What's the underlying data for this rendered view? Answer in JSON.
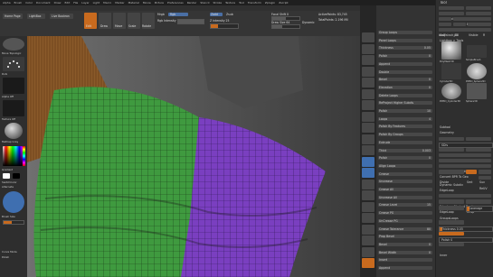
{
  "menu": {
    "items": [
      "Alpha",
      "Brush",
      "Color",
      "Document",
      "Draw",
      "Edit",
      "File",
      "Layer",
      "Light",
      "Macro",
      "Marker",
      "Material",
      "Movie",
      "Picture",
      "Preferences",
      "Render",
      "Stencil",
      "Stroke",
      "Texture",
      "Tool",
      "Transform",
      "Zplugin",
      "Zscript"
    ]
  },
  "toolbar": {
    "home_page": "Home Page",
    "lightbox": "LightBox",
    "live_boolean": "Live Boolean",
    "edit": "Edit",
    "draw": "Draw",
    "move": "Move",
    "scale": "Scale",
    "rotate": "Rotate",
    "mrgb": "Mrgb",
    "rgb": "Rgb",
    "rgb_intensity": "Rgb Intensity",
    "zadd": "Zadd",
    "zsub": "Zsub",
    "z_intensity": "Z Intensity 25",
    "focal_shift": "Focal Shift 0",
    "draw_size": "Draw Size 64",
    "dynamic": "Dynamic",
    "active_points": "ActivePoints: 83,745",
    "total_points": "TotalPoints: 2.196 Mil",
    "rgb_value": 1.0,
    "z_intensity_value": 0.25,
    "focal_value": 0.5,
    "draw_size_value": 0.35
  },
  "left_shelf": {
    "brush_label": "Move Topologic",
    "stroke_label": "Dots",
    "alpha_label": "Alpha Off",
    "texture_label": "Texture Off",
    "material_label": "MatCap Gray",
    "gradient_label": "Gradient",
    "switch_color": "SwitchColor",
    "alternate": "Alternate",
    "brush_size_label": "Brush Size",
    "curve_mode": "Curve Mode",
    "polish_label": "Polish"
  },
  "right_shelf": {
    "icons": [
      "bpr-icon",
      "spix-icon",
      "scroll-icon",
      "zoom-icon",
      "actual-icon",
      "aahalf-icon",
      "persp-icon",
      "floor-icon",
      "local-icon",
      "lsym-icon",
      "xyz-icon",
      "frame-icon",
      "move-icon",
      "scale-icon",
      "rotate-icon",
      "linefill-icon",
      "polyf-icon",
      "transp-icon",
      "ghost-icon",
      "solo-icon",
      "xpose-icon"
    ]
  },
  "mid_panel": {
    "sections": [
      {
        "label": "Group Loops",
        "value": ""
      },
      {
        "label": "Panel Loops",
        "value": ""
      },
      {
        "label": "Thickness",
        "value": "0.05"
      },
      {
        "label": "Polish",
        "value": "0"
      },
      {
        "label": "Append",
        "value": ""
      },
      {
        "label": "Double",
        "value": ""
      },
      {
        "label": "Bevel",
        "value": "0"
      },
      {
        "label": "Elevation",
        "value": "0"
      },
      {
        "label": "Delete Loops",
        "value": ""
      },
      {
        "label": "ReProject Higher Subdiv",
        "value": ""
      },
      {
        "label": "Polish",
        "value": "10"
      },
      {
        "label": "Loops",
        "value": "4"
      },
      {
        "label": "Polish By Features",
        "value": ""
      },
      {
        "label": "Polish By Groups",
        "value": ""
      },
      {
        "label": "Extrude",
        "value": ""
      },
      {
        "label": "Thick",
        "value": "0.003"
      },
      {
        "label": "Polish",
        "value": "0"
      },
      {
        "label": "Align Loops",
        "value": ""
      },
      {
        "label": "Crease",
        "value": ""
      },
      {
        "label": "Uncrease",
        "value": ""
      },
      {
        "label": "Crease All",
        "value": ""
      },
      {
        "label": "Uncrease All",
        "value": ""
      },
      {
        "label": "Crease Level",
        "value": "15"
      },
      {
        "label": "Crease PG",
        "value": ""
      },
      {
        "label": "UnCrease PG",
        "value": ""
      },
      {
        "label": "Crease Tolerance",
        "value": "80"
      },
      {
        "label": "Prop Bevel",
        "value": ""
      },
      {
        "label": "Bevel",
        "value": "0"
      },
      {
        "label": "Bevel Width",
        "value": "0"
      },
      {
        "label": "Insert",
        "value": ""
      },
      {
        "label": "Append",
        "value": ""
      }
    ]
  },
  "tool_panel": {
    "title": "Tool",
    "load_tool": "Load Tool",
    "save_as": "Save As",
    "import": "Import",
    "export": "Export",
    "clone": "Clone",
    "make_polymesh": "Make PolyMesh3D",
    "goz": "GoZ",
    "all": "All",
    "visible": "Visible",
    "lightbox_tools": "Lightbox > Tools",
    "subtool_name": "bodystack_08",
    "r_label": "R",
    "thumbs": [
      "PolyMesh3D",
      "SimpleBrush",
      "Cylinder3D",
      "PM3D_Sphere3D",
      "PM3D_Cylinder3D",
      "Sphere3D"
    ],
    "subtool": "Subtool",
    "geometry": "Geometry",
    "lower_res": "Lower Res",
    "higher_res": "Higher Res",
    "sdiv": "SDiv",
    "del_lower": "Del Lower",
    "del_higher": "Del Higher",
    "freeze_subdiv": "Freeze SubDivision Levels",
    "reconstruct_subdiv": "Reconstruct Subdiv",
    "convert_bpr": "Convert BPR To Geo",
    "divide": "Divide",
    "smt": "Smt",
    "suv": "Suv",
    "relax": "ReUV",
    "dynamic_subdiv": "Dynamic Subdiv",
    "edgeloop": "EdgeLoop",
    "edgeloop_masked": "Edgeloop Masked Border",
    "edgeloop_btn": "EdgeLoop",
    "crisp": "Crisp",
    "groupsloops": "GroupsLoops",
    "coverage": "Coverage",
    "panel_loops": "Panel Loops",
    "thickness": "Thickness 0.05",
    "append": "Append",
    "polish": "Polish 0",
    "inner": "Inner"
  }
}
